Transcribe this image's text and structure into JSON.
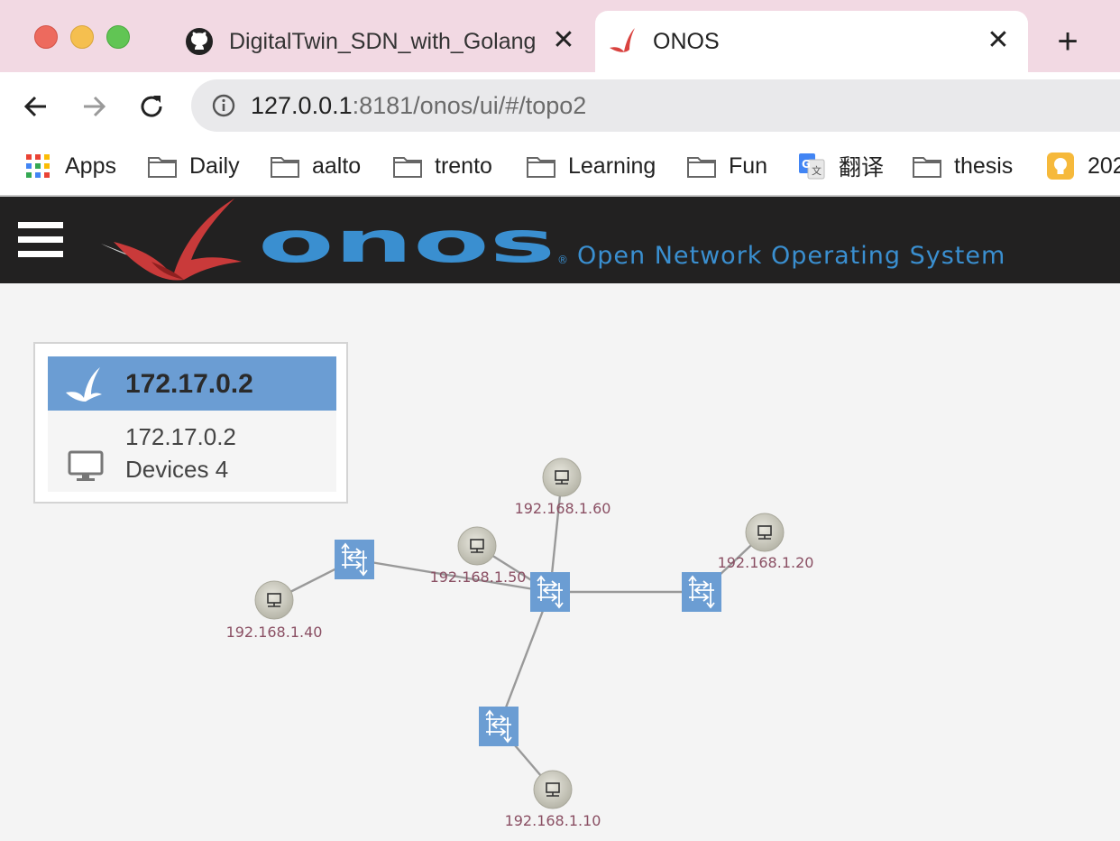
{
  "browser": {
    "tabs": [
      {
        "title": "DigitalTwin_SDN_with_Golang/",
        "icon": "github-icon"
      },
      {
        "title": "ONOS",
        "icon": "onos-bird-icon"
      }
    ],
    "url_host": "127.0.0.1",
    "url_path": ":8181/onos/ui/#/topo2",
    "bookmarks": [
      {
        "label": "Apps",
        "icon": "apps-grid-icon"
      },
      {
        "label": "Daily",
        "icon": "folder-icon"
      },
      {
        "label": "aalto",
        "icon": "folder-icon"
      },
      {
        "label": "trento",
        "icon": "folder-icon"
      },
      {
        "label": "Learning",
        "icon": "folder-icon"
      },
      {
        "label": "Fun",
        "icon": "folder-icon"
      },
      {
        "label": "翻译",
        "icon": "google-translate-icon"
      },
      {
        "label": "thesis",
        "icon": "folder-icon"
      },
      {
        "label": "202",
        "icon": "lightbulb-icon"
      }
    ]
  },
  "masthead": {
    "logo_text": "onos",
    "registered": "®",
    "tagline": "Open Network Operating System"
  },
  "summary_panel": {
    "title": "172.17.0.2",
    "cluster_ip": "172.17.0.2",
    "devices_text": "Devices 4"
  },
  "topology": {
    "hosts": [
      "192.168.1.60",
      "192.168.1.50",
      "192.168.1.20",
      "192.168.1.40",
      "192.168.1.10"
    ],
    "switch_count": 4
  },
  "colors": {
    "tab_strip": "#f2d9e3",
    "masthead": "#222121",
    "onos_blue": "#3a8fd0",
    "switch_blue": "#6b9dd3",
    "host_label": "#8a4f63"
  }
}
